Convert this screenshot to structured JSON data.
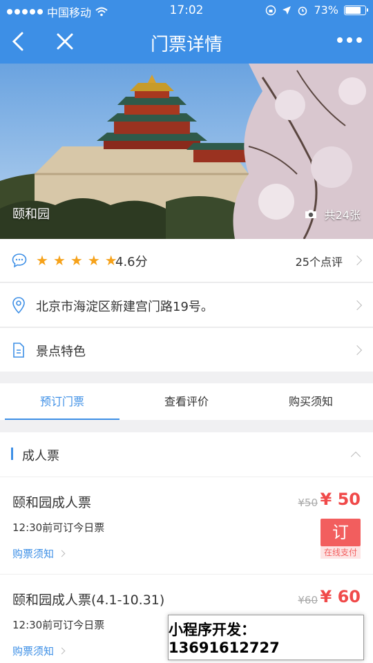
{
  "status": {
    "carrier": "中国移动",
    "time": "17:02",
    "battery": "73%"
  },
  "nav": {
    "title": "门票详情"
  },
  "hero": {
    "name": "颐和园",
    "photo_count": "共24张"
  },
  "rating": {
    "score": "4.6分",
    "stars": 5,
    "reviews": "25个点评"
  },
  "address": "北京市海淀区新建宫门路19号。",
  "feature": "景点特色",
  "tabs": [
    {
      "label": "预订门票",
      "active": true
    },
    {
      "label": "查看评价",
      "active": false
    },
    {
      "label": "购买须知",
      "active": false
    }
  ],
  "section": {
    "label": "成人票"
  },
  "tickets": [
    {
      "name": "颐和园成人票",
      "note": "12:30前可订今日票",
      "link": "购票须知",
      "old_price": "¥50",
      "price": "¥ 50",
      "order": "订",
      "order_sub": "在线支付"
    },
    {
      "name": "颐和园成人票(4.1-10.31)",
      "note": "12:30前可订今日票",
      "link": "购票须知",
      "old_price": "¥60",
      "price": "¥ 60"
    }
  ],
  "promo": "小程序开发：13691612727",
  "colors": {
    "primary": "#3d8fe6",
    "price": "#f04a4a",
    "star": "#f6a21a"
  }
}
